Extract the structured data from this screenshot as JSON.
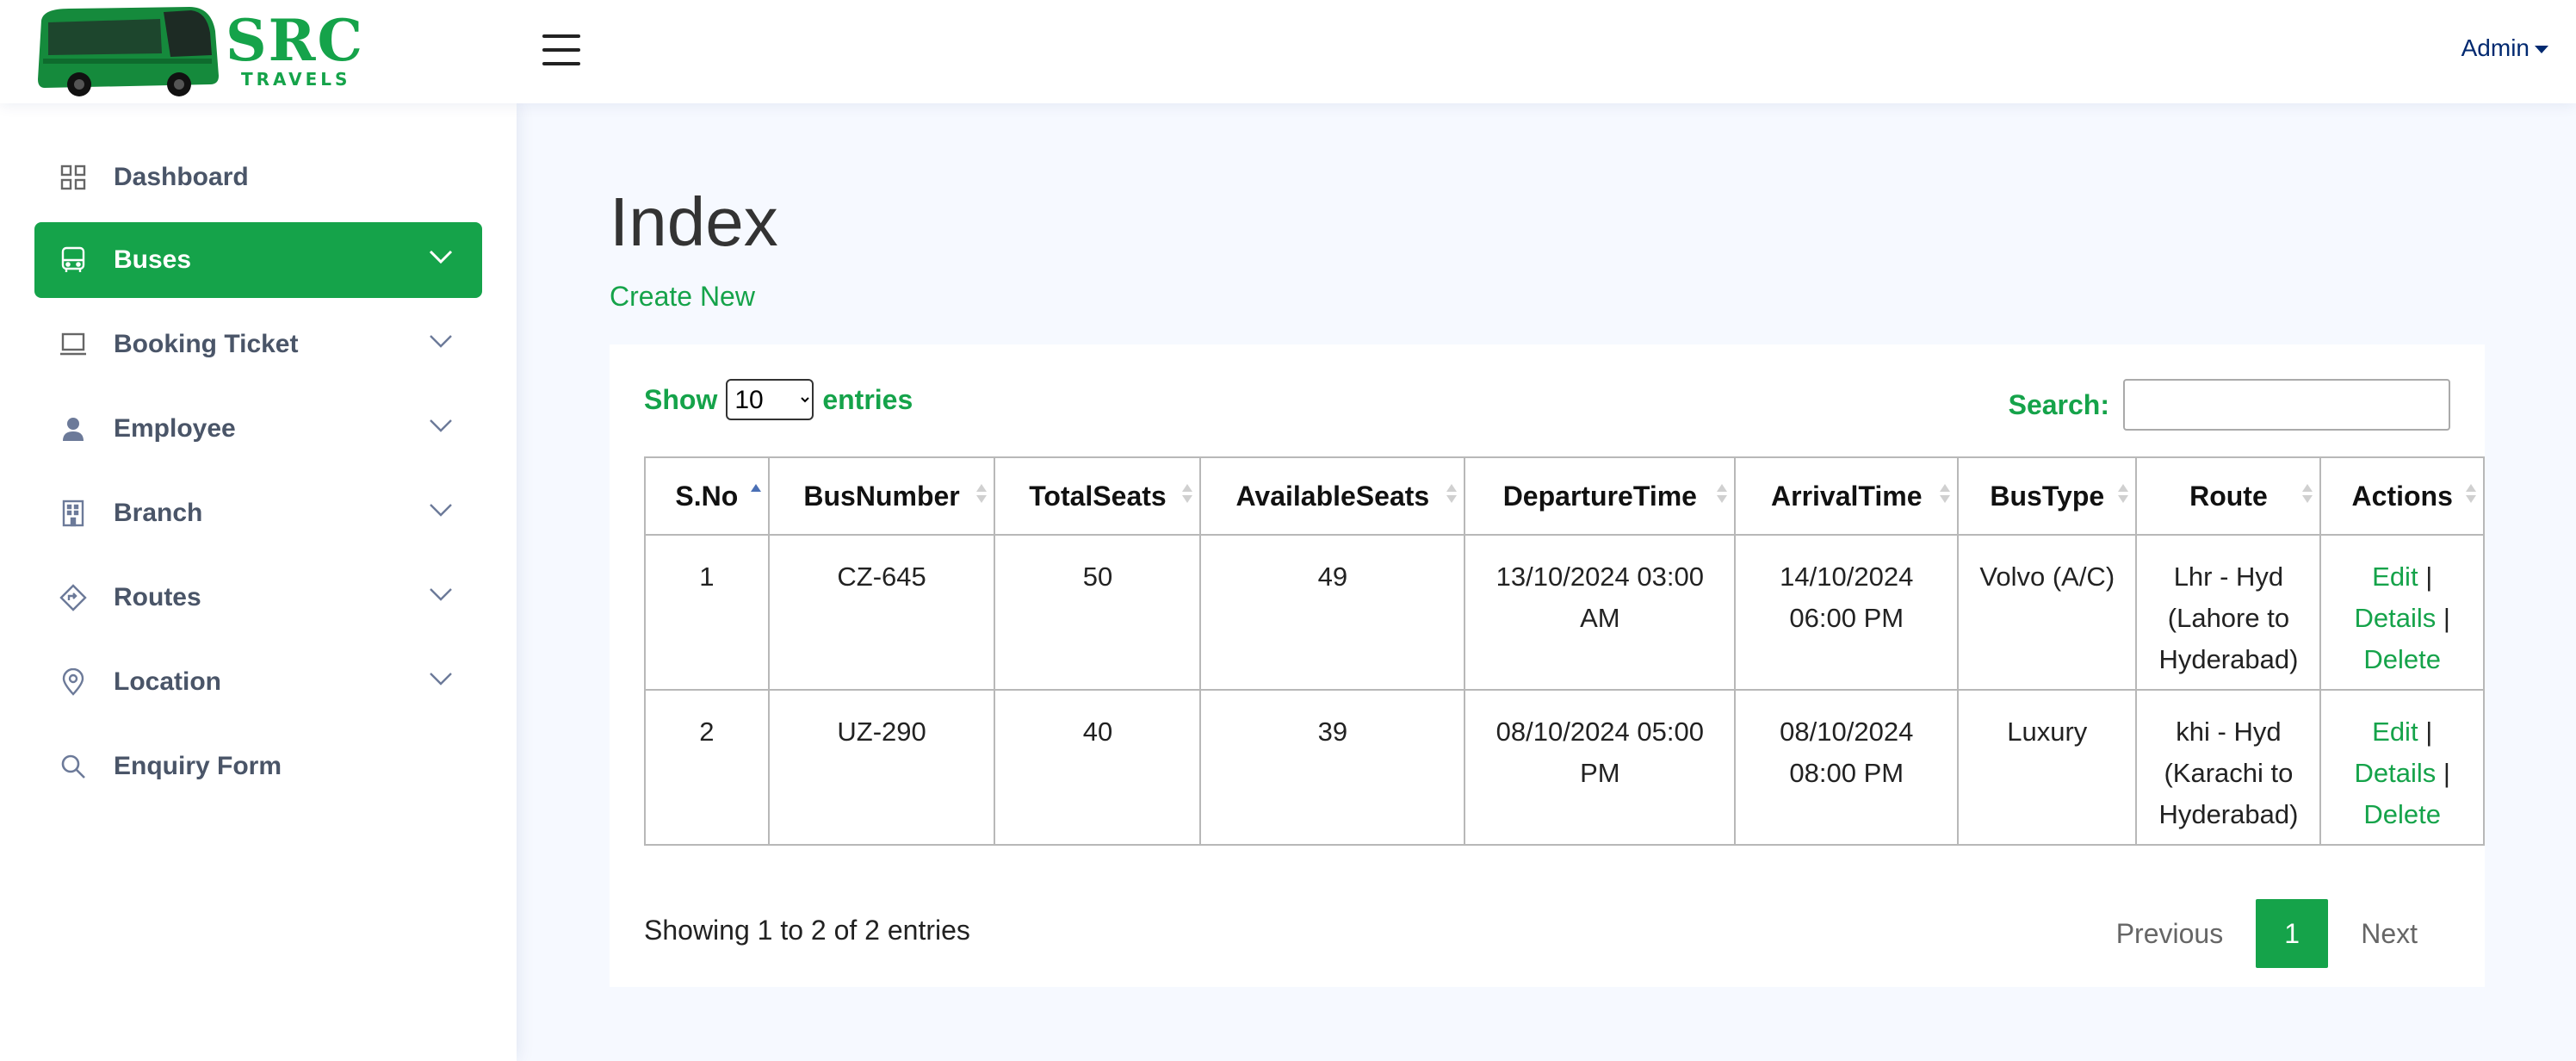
{
  "header": {
    "brand_name": "SRC",
    "brand_sub": "TRAVELS",
    "user_menu": "Admin"
  },
  "sidebar": {
    "items": [
      {
        "label": "Dashboard",
        "icon": "grid-icon"
      },
      {
        "label": "Buses",
        "icon": "bus-icon",
        "active": true
      },
      {
        "label": "Booking Ticket",
        "icon": "laptop-icon"
      },
      {
        "label": "Employee",
        "icon": "person-icon"
      },
      {
        "label": "Branch",
        "icon": "building-icon"
      },
      {
        "label": "Routes",
        "icon": "signpost-icon"
      },
      {
        "label": "Location",
        "icon": "map-pin-icon"
      },
      {
        "label": "Enquiry Form",
        "icon": "search-icon"
      }
    ]
  },
  "main": {
    "title": "Index",
    "create_new": "Create New",
    "show_label": "Show",
    "show_value": "10",
    "entries_label": "entries",
    "search_label": "Search:",
    "search_value": ""
  },
  "table": {
    "columns": [
      "S.No",
      "BusNumber",
      "TotalSeats",
      "AvailableSeats",
      "DepartureTime",
      "ArrivalTime",
      "BusType",
      "Route",
      "Actions"
    ],
    "rows": [
      {
        "sno": "1",
        "bus_number": "CZ-645",
        "total_seats": "50",
        "available_seats": "49",
        "departure_1": "13/10/2024 03:00",
        "departure_2": "AM",
        "arrival_1": "14/10/2024",
        "arrival_2": "06:00 PM",
        "bus_type": "Volvo (A/C)",
        "route_1": "Lhr - Hyd",
        "route_2": "(Lahore to",
        "route_3": "Hyderabad)"
      },
      {
        "sno": "2",
        "bus_number": "UZ-290",
        "total_seats": "40",
        "available_seats": "39",
        "departure_1": "08/10/2024 05:00",
        "departure_2": "PM",
        "arrival_1": "08/10/2024",
        "arrival_2": "08:00 PM",
        "bus_type": "Luxury",
        "route_1": "khi - Hyd",
        "route_2": "(Karachi to",
        "route_3": "Hyderabad)"
      }
    ],
    "actions": {
      "edit": "Edit",
      "details": "Details",
      "delete": "Delete",
      "separator": "|"
    }
  },
  "footer": {
    "info": "Showing 1 to 2 of 2 entries",
    "previous": "Previous",
    "current_page": "1",
    "next": "Next"
  },
  "colors": {
    "accent": "#15a34a",
    "background": "#f6f9ff"
  }
}
